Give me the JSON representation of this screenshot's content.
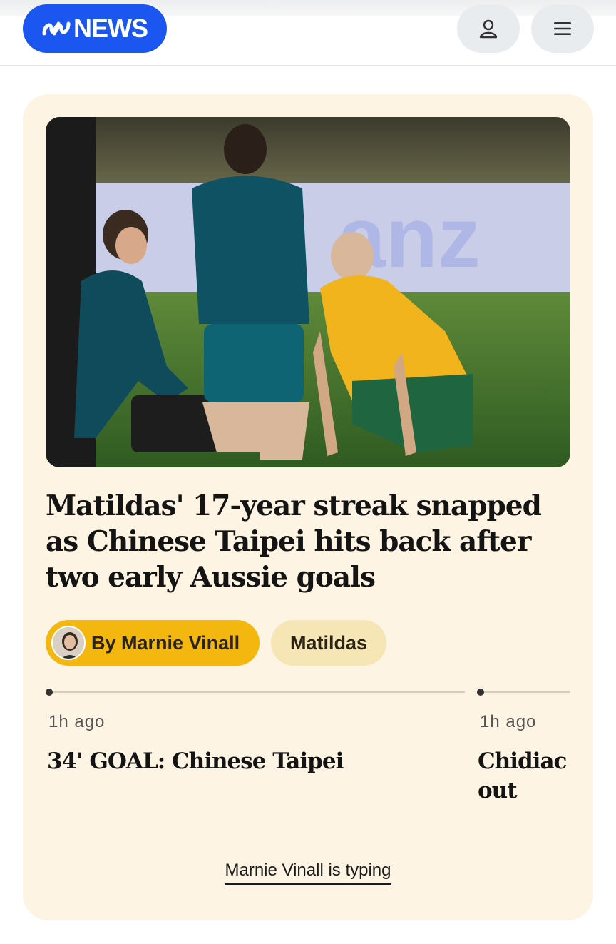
{
  "header": {
    "logo_text": "NEWS",
    "user_icon": "user-icon",
    "menu_icon": "hamburger-menu-icon"
  },
  "article": {
    "headline": "Matildas' 17-year streak snapped as Chinese Taipei hits back after two early Aussie goals",
    "author_chip": "By Marnie Vinall",
    "tag_chip": "Matildas"
  },
  "live_posts": [
    {
      "time": "1h ago",
      "title": "34' GOAL: Chinese Taipei"
    },
    {
      "time": "1h ago",
      "title": "Chidiac out"
    }
  ],
  "typing_indicator": "Marnie Vinall is typing",
  "colors": {
    "brand_blue": "#1c56f0",
    "card_bg": "#fdf4e3",
    "author_chip": "#f3b70f",
    "tag_chip": "#f6e6b5"
  }
}
